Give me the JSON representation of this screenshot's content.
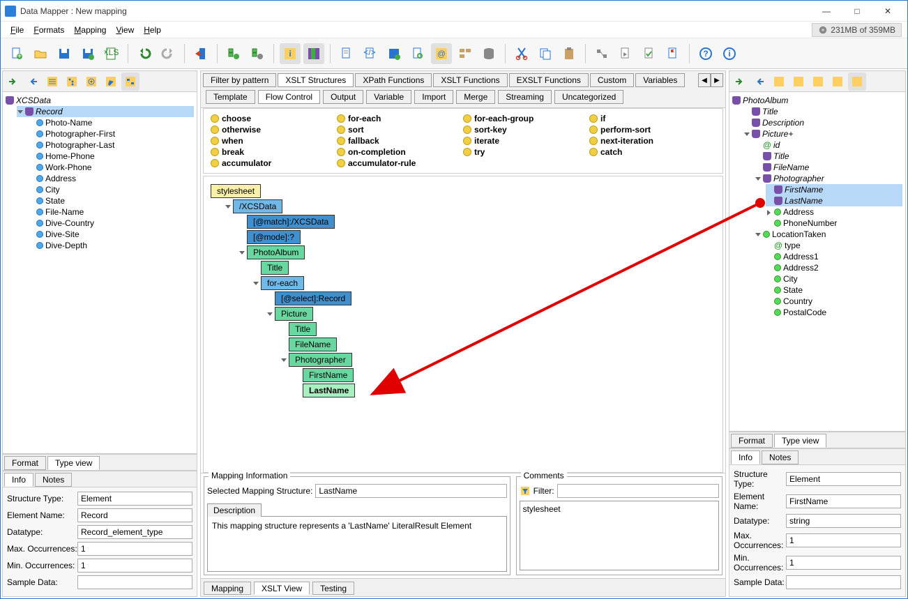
{
  "window": {
    "title": "Data Mapper : New mapping"
  },
  "menu": {
    "file": "File",
    "formats": "Formats",
    "mapping": "Mapping",
    "view": "View",
    "help": "Help"
  },
  "memory": "231MB of 359MB",
  "leftTree": {
    "root": "XCSData",
    "record": "Record",
    "fields": [
      "Photo-Name",
      "Photographer-First",
      "Photographer-Last",
      "Home-Phone",
      "Work-Phone",
      "Address",
      "City",
      "State",
      "File-Name",
      "Dive-Country",
      "Dive-Site",
      "Dive-Depth"
    ]
  },
  "rightTree": {
    "root": "PhotoAlbum",
    "title": "Title",
    "description": "Description",
    "picture": "Picture+",
    "id": "id",
    "ptitle": "Title",
    "filename": "FileName",
    "photographer": "Photographer",
    "firstname": "FirstName",
    "lastname": "LastName",
    "address": "Address",
    "phone": "PhoneNumber",
    "location": "LocationTaken",
    "type": "type",
    "addr1": "Address1",
    "addr2": "Address2",
    "city": "City",
    "state": "State",
    "country": "Country",
    "postal": "PostalCode"
  },
  "tabs": {
    "format": "Format",
    "typeview": "Type view",
    "info": "Info",
    "notes": "Notes"
  },
  "leftInfo": {
    "structLabel": "Structure Type:",
    "struct": "Element",
    "nameLabel": "Element Name:",
    "name": "Record",
    "dtLabel": "Datatype:",
    "dt": "Record_element_type",
    "maxLabel": "Max. Occurrences:",
    "max": "1",
    "minLabel": "Min. Occurrences:",
    "min": "1",
    "sampleLabel": "Sample Data:"
  },
  "rightInfo": {
    "structLabel": "Structure Type:",
    "struct": "Element",
    "nameLabel": "Element Name:",
    "name": "FirstName",
    "dtLabel": "Datatype:",
    "dt": "string",
    "maxLabel": "Max. Occurrences:",
    "max": "1",
    "minLabel": "Min. Occurrences:",
    "min": "1",
    "sampleLabel": "Sample Data:"
  },
  "centerTabs": {
    "filter": "Filter by pattern",
    "xsltStruct": "XSLT Structures",
    "xpath": "XPath Functions",
    "xsltFunc": "XSLT Functions",
    "exslt": "EXSLT Functions",
    "custom": "Custom",
    "variables": "Variables"
  },
  "subTabs": {
    "template": "Template",
    "flow": "Flow Control",
    "output": "Output",
    "variable": "Variable",
    "import": "Import",
    "merge": "Merge",
    "streaming": "Streaming",
    "uncat": "Uncategorized"
  },
  "funcs": {
    "c1": [
      "choose",
      "otherwise",
      "when",
      "break",
      "accumulator"
    ],
    "c2": [
      "for-each",
      "sort",
      "fallback",
      "on-completion",
      "accumulator-rule"
    ],
    "c3": [
      "for-each-group",
      "sort-key",
      "iterate",
      "try"
    ],
    "c4": [
      "if",
      "perform-sort",
      "next-iteration",
      "catch"
    ]
  },
  "mapNodes": {
    "stylesheet": "stylesheet",
    "xcs": "/XCSData",
    "match": "[@match]:/XCSData",
    "mode": "[@mode]:?",
    "album": "PhotoAlbum",
    "title": "Title",
    "foreach": "for-each",
    "select": "[@select]:Record",
    "picture": "Picture",
    "ptitle": "Title",
    "filename": "FileName",
    "photographer": "Photographer",
    "firstname": "FirstName",
    "lastname": "LastName"
  },
  "mapInfo": {
    "legend": "Mapping Information",
    "selLabel": "Selected Mapping Structure:",
    "selValue": "LastName",
    "descTab": "Description",
    "descText": "This mapping structure represents a 'LastName' LiteralResult Element"
  },
  "comments": {
    "legend": "Comments",
    "filterLabel": "Filter:",
    "body": "stylesheet"
  },
  "bottomTabs": {
    "mapping": "Mapping",
    "xslt": "XSLT View",
    "testing": "Testing"
  }
}
